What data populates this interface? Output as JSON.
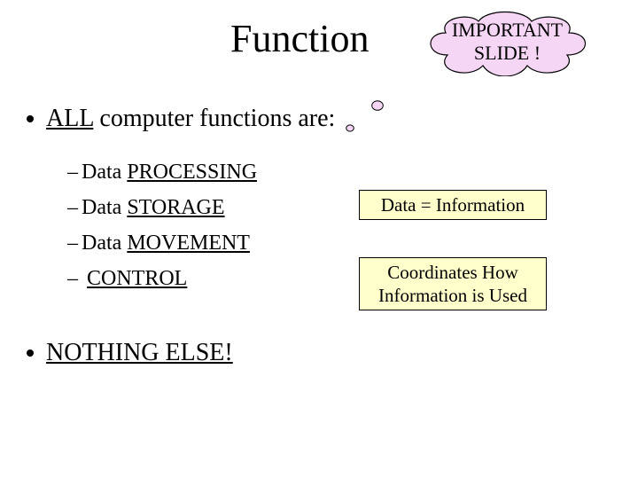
{
  "title": "Function",
  "callout": {
    "line1": "IMPORTANT",
    "line2": "SLIDE !"
  },
  "bullets": {
    "main1_prefix_underlined": "ALL",
    "main1_rest": " computer functions are:",
    "sub": [
      {
        "prefix": "Data ",
        "underlined": "PROCESSING"
      },
      {
        "prefix": "Data ",
        "underlined": "STORAGE"
      },
      {
        "prefix": "Data ",
        "underlined": "MOVEMENT"
      },
      {
        "prefix": " ",
        "underlined": "CONTROL"
      }
    ],
    "main2_underlined": "NOTHING ELSE!"
  },
  "boxes": {
    "box1": "Data  =  Information",
    "box2_line1": "Coordinates How",
    "box2_line2": "Information is Used"
  },
  "colors": {
    "cloud_fill": "#f5d6f5",
    "box_fill": "#ffffcc"
  }
}
